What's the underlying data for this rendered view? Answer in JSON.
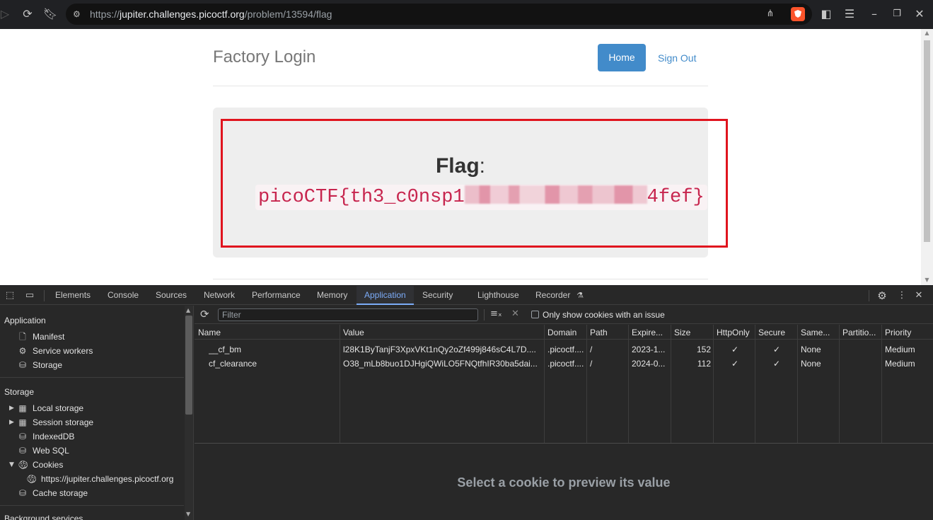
{
  "browser": {
    "url_scheme": "https://",
    "url_host": "jupiter.challenges.picoctf.org",
    "url_path": "/problem/13594/flag"
  },
  "page": {
    "brand": "Factory Login",
    "nav": {
      "home": "Home",
      "sign_out": "Sign Out"
    },
    "flag_label": "Flag",
    "flag_colon": ":",
    "flag_prefix": "picoCTF{th3_c0nsp1",
    "flag_suffix": "4fef}"
  },
  "devtools": {
    "tabs": [
      "Elements",
      "Console",
      "Sources",
      "Network",
      "Performance",
      "Memory",
      "Application",
      "Security",
      "Lighthouse",
      "Recorder"
    ],
    "active_tab": "Application",
    "sidebar": {
      "application_header": "Application",
      "application_items": [
        "Manifest",
        "Service workers",
        "Storage"
      ],
      "storage_header": "Storage",
      "storage_items": [
        "Local storage",
        "Session storage",
        "IndexedDB",
        "Web SQL",
        "Cookies"
      ],
      "cookie_origin": "https://jupiter.challenges.picoctf.org",
      "cache_item": "Cache storage",
      "background_header": "Background services"
    },
    "cookies": {
      "filter_placeholder": "Filter",
      "only_issues_label": "Only show cookies with an issue",
      "columns": [
        "Name",
        "Value",
        "Domain",
        "Path",
        "Expire...",
        "Size",
        "HttpOnly",
        "Secure",
        "Same...",
        "Partitio...",
        "Priority"
      ],
      "rows": [
        {
          "name": "__cf_bm",
          "value": "l28K1ByTanjF3XpxVKt1nQy2oZf499j846sC4L7D....",
          "domain": ".picoctf....",
          "path": "/",
          "expires": "2023-1...",
          "size": "152",
          "httponly": "✓",
          "secure": "✓",
          "samesite": "None",
          "partition": "",
          "priority": "Medium"
        },
        {
          "name": "cf_clearance",
          "value": "O38_mLb8buo1DJHgiQWiLO5FNQtfhIR30ba5dai...",
          "domain": ".picoctf....",
          "path": "/",
          "expires": "2024-0...",
          "size": "112",
          "httponly": "✓",
          "secure": "✓",
          "samesite": "None",
          "partition": "",
          "priority": "Medium"
        }
      ],
      "preview_message": "Select a cookie to preview its value"
    }
  }
}
